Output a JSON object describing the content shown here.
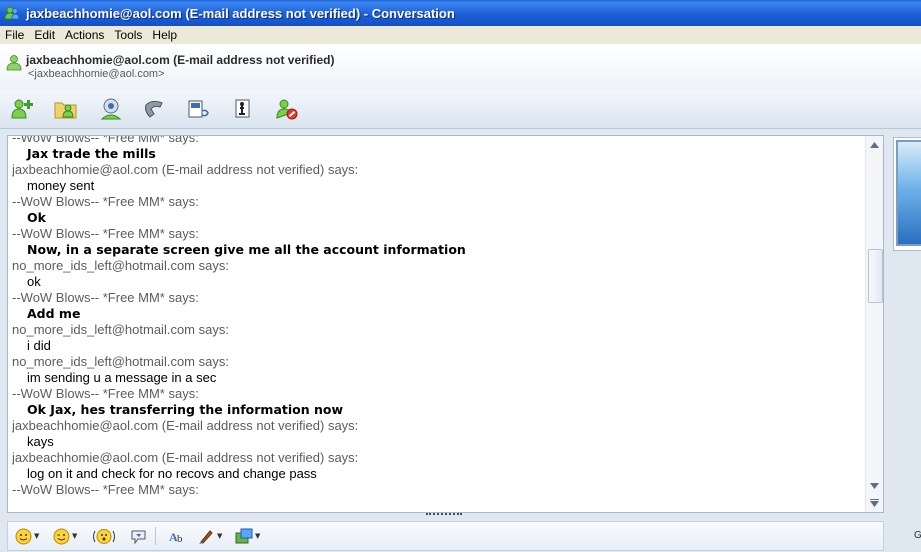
{
  "window": {
    "title": "jaxbeachhomie@aol.com (E-mail address not verified) - Conversation"
  },
  "menu": [
    "File",
    "Edit",
    "Actions",
    "Tools",
    "Help"
  ],
  "contact": {
    "name": "jaxbeachhomie@aol.com (E-mail address not verified)",
    "email": "<jaxbeachhomie@aol.com>"
  },
  "toolbar_icons": [
    "invite-contact-icon",
    "send-files-icon",
    "video-call-icon",
    "call-icon",
    "activities-icon",
    "games-icon",
    "block-icon"
  ],
  "conversation": [
    {
      "kind": "says",
      "text": "--WoW Blows-- *Free MM* says:",
      "cut": "top"
    },
    {
      "kind": "msg-bold",
      "text": "Jax trade the mills"
    },
    {
      "kind": "says",
      "text": "jaxbeachhomie@aol.com (E-mail address not verified) says:"
    },
    {
      "kind": "msg",
      "text": "money sent"
    },
    {
      "kind": "says",
      "text": "--WoW Blows-- *Free MM* says:"
    },
    {
      "kind": "msg-bold",
      "text": "Ok"
    },
    {
      "kind": "says",
      "text": "--WoW Blows-- *Free MM* says:"
    },
    {
      "kind": "msg-bold",
      "text": "Now, in a separate screen give me all the account information"
    },
    {
      "kind": "says",
      "text": "no_more_ids_left@hotmail.com says:"
    },
    {
      "kind": "msg",
      "text": "ok"
    },
    {
      "kind": "says",
      "text": "--WoW Blows-- *Free MM* says:"
    },
    {
      "kind": "msg-bold",
      "text": "Add me"
    },
    {
      "kind": "says",
      "text": "no_more_ids_left@hotmail.com says:"
    },
    {
      "kind": "msg",
      "text": "i did"
    },
    {
      "kind": "says",
      "text": "no_more_ids_left@hotmail.com says:"
    },
    {
      "kind": "msg",
      "text": "im sending u a message in a sec"
    },
    {
      "kind": "says",
      "text": "--WoW Blows-- *Free MM* says:"
    },
    {
      "kind": "msg-bold",
      "text": "Ok Jax, hes transferring the information now"
    },
    {
      "kind": "says",
      "text": "jaxbeachhomie@aol.com (E-mail address not verified) says:"
    },
    {
      "kind": "msg",
      "text": "kays"
    },
    {
      "kind": "says",
      "text": "jaxbeachhomie@aol.com (E-mail address not verified) says:"
    },
    {
      "kind": "msg",
      "text": "log on it and check for no recovs and change pass"
    },
    {
      "kind": "says",
      "text": "--WoW Blows-- *Free MM* says:"
    }
  ],
  "format_icons": [
    "emoticon-icon",
    "wink-icon",
    "nudge-icon",
    "voice-clip-icon",
    "font-icon",
    "background-icon",
    "handwriting-icon"
  ],
  "side_label": "G",
  "colors": {
    "titlebar": "#1d5fd6",
    "menubar": "#ece9d8",
    "says_text": "#5c5c5c",
    "window_bg": "#dfe8f1"
  }
}
